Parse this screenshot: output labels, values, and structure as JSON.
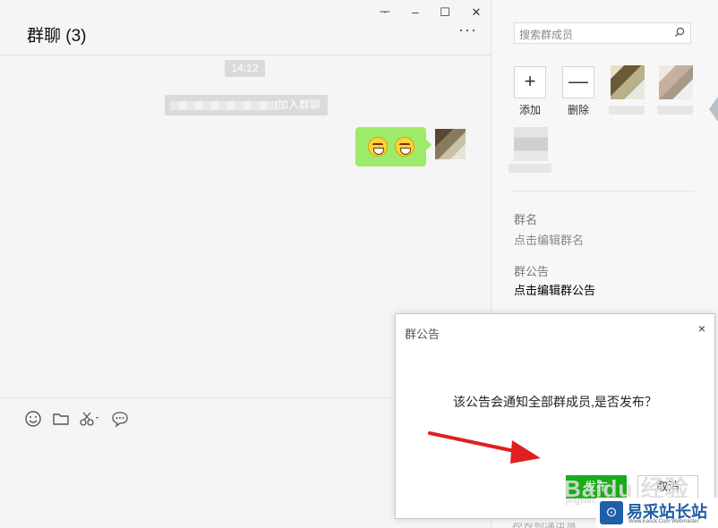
{
  "chat": {
    "title": "群聊 (3)",
    "more": "···",
    "window_buttons": [
      "ᅮ",
      "–",
      "☐",
      "✕"
    ],
    "timestamp": "14:12",
    "system_message_suffix": "加入群聊",
    "toolbar_icons": [
      "emoji-icon",
      "folder-icon",
      "scissors-icon",
      "chat-bubble-icon"
    ]
  },
  "side": {
    "search_placeholder": "搜索群成员",
    "add_label": "添加",
    "remove_label": "删除",
    "add_symbol": "+",
    "remove_symbol": "—",
    "group_name_label": "群名",
    "group_name_value": "点击编辑群名",
    "notice_label": "群公告",
    "notice_value": "点击编辑群公告",
    "bottom_cut_text": "保存到通讯录"
  },
  "dialog": {
    "title": "群公告",
    "close": "×",
    "message": "该公告会通知全部群成员,是否发布？",
    "confirm_label": "发布",
    "cancel_label": "取消",
    "watermark": "Baidu 经验",
    "watermark_sub": "jingyan.baidu.com"
  },
  "badge": {
    "logo": "⊙",
    "text": "易采站长站",
    "sub": "Www.Easck.Com  Webmaster"
  },
  "colors": {
    "bubble_green": "#9eea6a",
    "confirm_green": "#1aad19",
    "arrow_red": "#e02020",
    "badge_blue": "#1e5fa8"
  }
}
